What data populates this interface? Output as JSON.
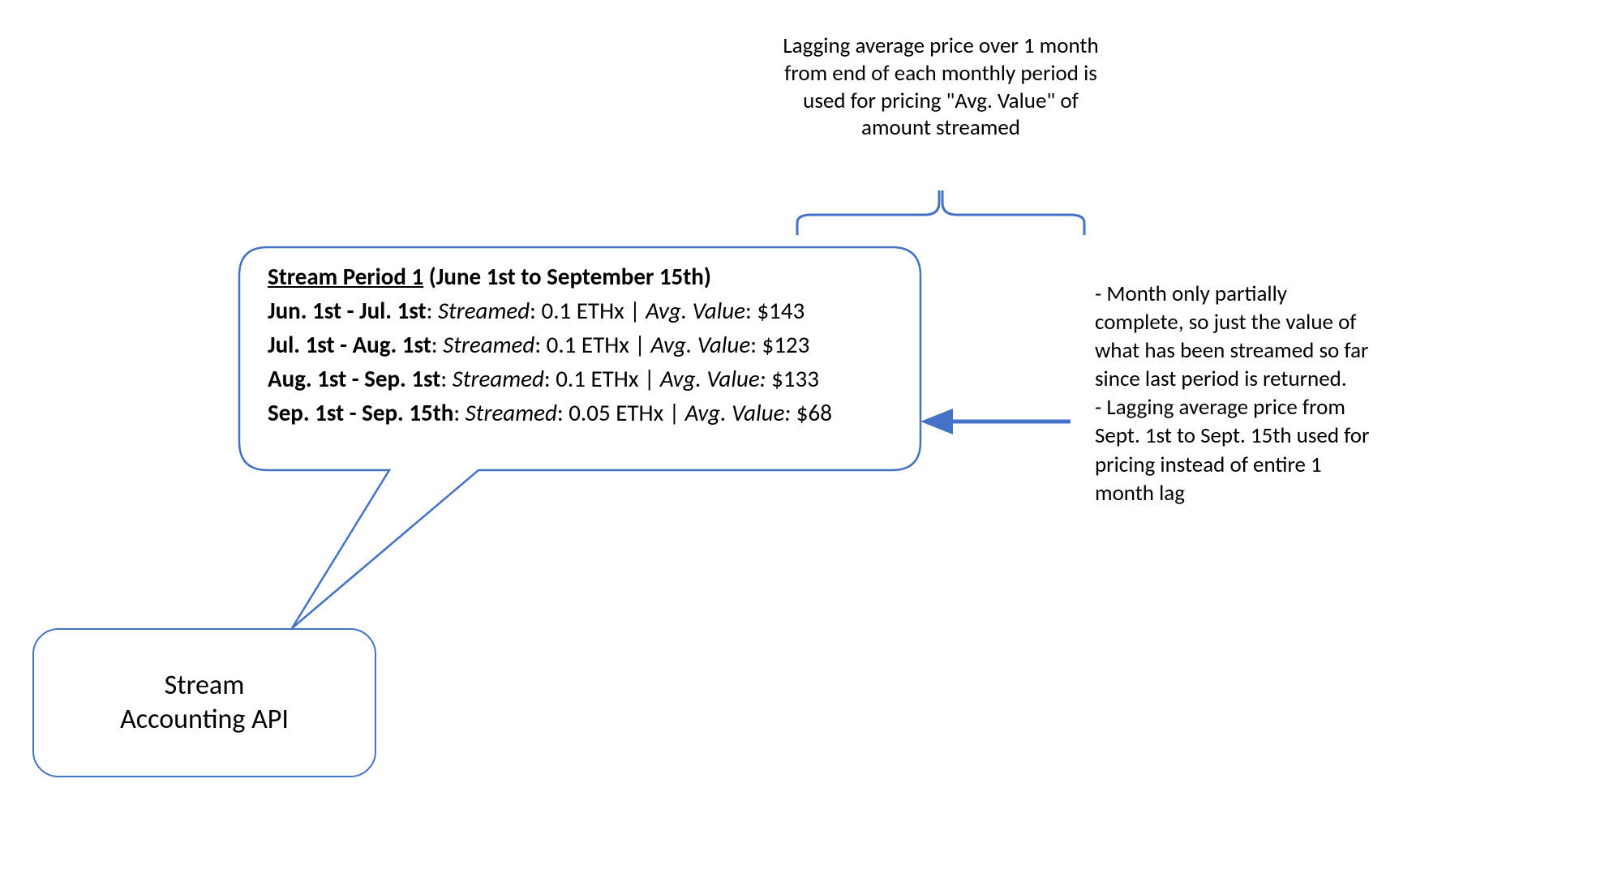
{
  "top_annotation": "Lagging average price over 1 month from end of each monthly period is used for pricing \"Avg. Value\" of amount streamed",
  "bubble": {
    "title_name": "Stream Period 1",
    "title_range": " (June 1st to September 15th)",
    "rows": [
      {
        "date": "Jun. 1st - Jul. 1st",
        "streamed_label": "Streamed",
        "streamed_value": "0.1 ETHx",
        "avg_label": "Avg. Value",
        "avg_value": "$143"
      },
      {
        "date": "Jul. 1st - Aug. 1st",
        "streamed_label": "Streamed",
        "streamed_value": "0.1 ETHx",
        "avg_label": "Avg. Value",
        "avg_value": "$123"
      },
      {
        "date": "Aug. 1st - Sep. 1st",
        "streamed_label": "Streamed",
        "streamed_value": "0.1 ETHx",
        "avg_label": "Avg. Value:",
        "avg_value": "$133"
      },
      {
        "date": "Sep. 1st - Sep. 15th",
        "streamed_label": "Streamed",
        "streamed_value": "0.05 ETHx",
        "avg_label": "Avg. Value:",
        "avg_value": "$68"
      }
    ]
  },
  "right_annotation": "- Month only partially complete, so just the value of what has been streamed so far since last period is returned.\n- Lagging average price from Sept. 1st to Sept. 15th used for pricing instead of entire 1 month lag",
  "node_label": "Stream\nAccounting API",
  "colors": {
    "stroke": "#4472C4",
    "fill": "#4472C4"
  }
}
